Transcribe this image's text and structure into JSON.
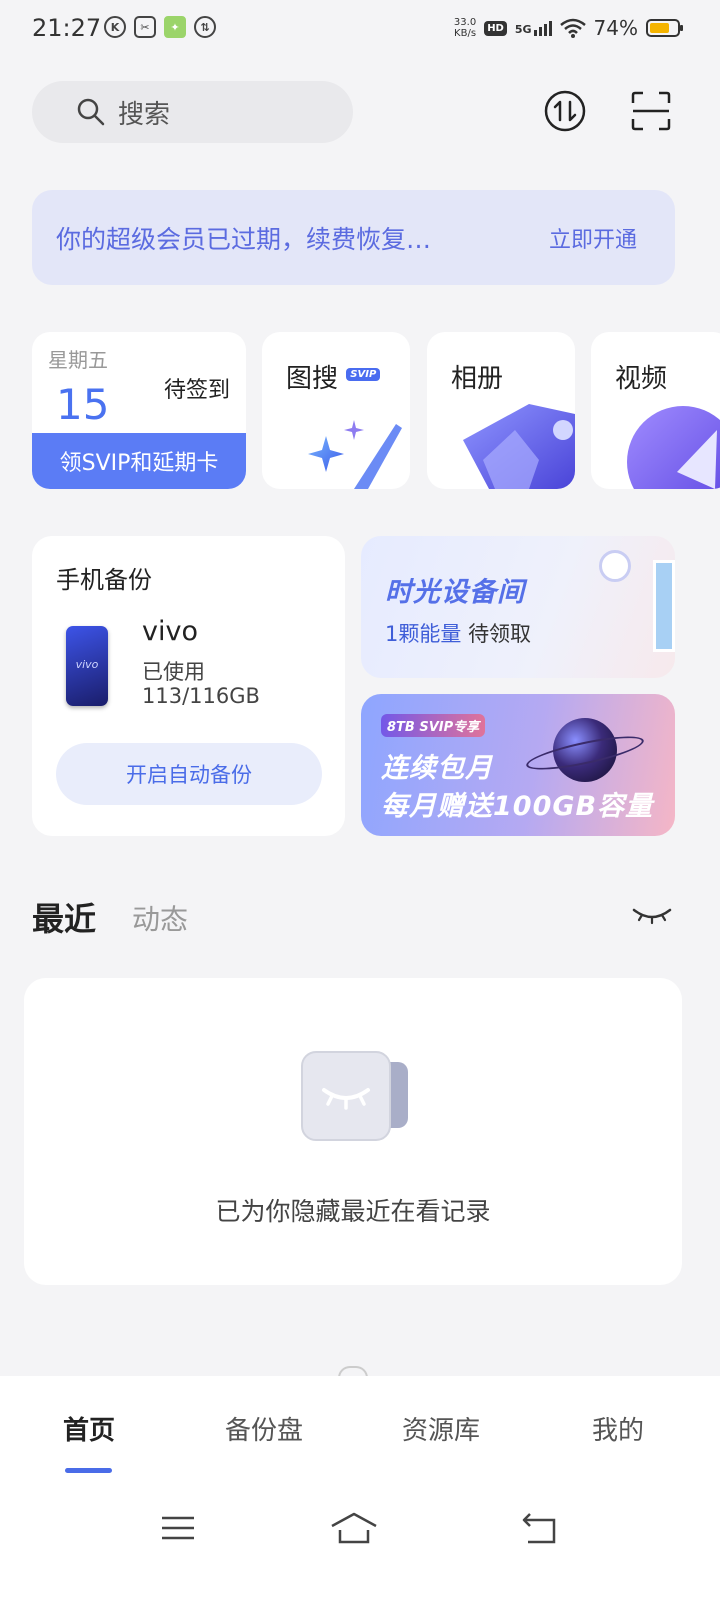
{
  "status_bar": {
    "time": "21:27",
    "net_speed_value": "33.0",
    "net_speed_unit": "KB/s",
    "hd": "HD",
    "network": "5G",
    "battery_percent": "74%",
    "battery_level": 0.74,
    "battery_color": "#f5b400"
  },
  "search": {
    "placeholder": "搜索"
  },
  "banner": {
    "text": "你的超级会员已过期，续费恢复…",
    "action": "立即开通"
  },
  "checkin": {
    "weekday": "星期五",
    "day": "15",
    "status": "待签到",
    "action": "领SVIP和延期卡"
  },
  "features": [
    {
      "label": "图搜",
      "badge": "SVIP"
    },
    {
      "label": "相册"
    },
    {
      "label": "视频"
    }
  ],
  "backup": {
    "title": "手机备份",
    "device_name": "vivo",
    "phone_logo": "vivo",
    "used_label": "已使用",
    "used_value": "113/116GB",
    "button": "开启自动备份"
  },
  "promo_time": {
    "title": "时光设备间",
    "highlight": "1颗能量",
    "status": "待领取"
  },
  "promo_svip": {
    "badge": "8TB SVIP专享",
    "line1": "连续包月",
    "line2": "每月赠送100GB容量"
  },
  "recent": {
    "tab_recent": "最近",
    "tab_activity": "动态",
    "hidden_message": "已为你隐藏最近在看记录"
  },
  "bottom_nav": {
    "items": [
      "首页",
      "备份盘",
      "资源库",
      "我的"
    ],
    "active_index": 0
  },
  "colors": {
    "accent": "#4a6ce8",
    "banner_bg": "#e3e6f8",
    "checkin_bar": "#5b7cf5"
  }
}
